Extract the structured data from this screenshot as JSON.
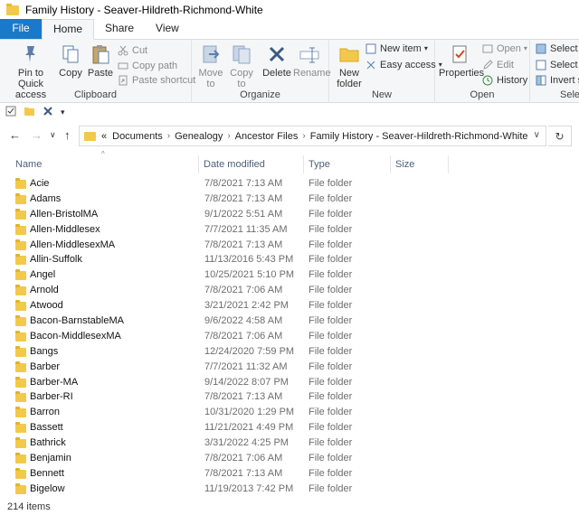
{
  "window": {
    "title": "Family History - Seaver-Hildreth-Richmond-White"
  },
  "tabs": [
    "File",
    "Home",
    "Share",
    "View"
  ],
  "ribbon": {
    "clipboard": {
      "label": "Clipboard",
      "pin": "Pin to Quick access",
      "copy": "Copy",
      "paste": "Paste",
      "cut": "Cut",
      "copy_path": "Copy path",
      "paste_shortcut": "Paste shortcut"
    },
    "organize": {
      "label": "Organize",
      "move_to": "Move to",
      "copy_to": "Copy to",
      "delete": "Delete",
      "rename": "Rename"
    },
    "new": {
      "label": "New",
      "new_folder": "New folder",
      "new_item": "New item",
      "easy_access": "Easy access"
    },
    "open": {
      "label": "Open",
      "properties": "Properties",
      "open": "Open",
      "edit": "Edit",
      "history": "History"
    },
    "select": {
      "label": "Selec",
      "select_all": "Select a",
      "select_none": "Select n",
      "invert": "Invert s"
    }
  },
  "address": {
    "prefix": "«",
    "crumbs": [
      "Documents",
      "Genealogy",
      "Ancestor Files",
      "Family History - Seaver-Hildreth-Richmond-White"
    ]
  },
  "columns": [
    "Name",
    "Date modified",
    "Type",
    "Size"
  ],
  "files": [
    {
      "name": "Acie",
      "date": "7/8/2021 7:13 AM",
      "type": "File folder"
    },
    {
      "name": "Adams",
      "date": "7/8/2021 7:13 AM",
      "type": "File folder"
    },
    {
      "name": "Allen-BristolMA",
      "date": "9/1/2022 5:51 AM",
      "type": "File folder"
    },
    {
      "name": "Allen-Middlesex",
      "date": "7/7/2021 11:35 AM",
      "type": "File folder"
    },
    {
      "name": "Allen-MiddlesexMA",
      "date": "7/8/2021 7:13 AM",
      "type": "File folder"
    },
    {
      "name": "Allin-Suffolk",
      "date": "11/13/2016 5:43 PM",
      "type": "File folder"
    },
    {
      "name": "Angel",
      "date": "10/25/2021 5:10 PM",
      "type": "File folder"
    },
    {
      "name": "Arnold",
      "date": "7/8/2021 7:06 AM",
      "type": "File folder"
    },
    {
      "name": "Atwood",
      "date": "3/21/2021 2:42 PM",
      "type": "File folder"
    },
    {
      "name": "Bacon-BarnstableMA",
      "date": "9/6/2022 4:58 AM",
      "type": "File folder"
    },
    {
      "name": "Bacon-MiddlesexMA",
      "date": "7/8/2021 7:06 AM",
      "type": "File folder"
    },
    {
      "name": "Bangs",
      "date": "12/24/2020 7:59 PM",
      "type": "File folder"
    },
    {
      "name": "Barber",
      "date": "7/7/2021 11:32 AM",
      "type": "File folder"
    },
    {
      "name": "Barber-MA",
      "date": "9/14/2022 8:07 PM",
      "type": "File folder"
    },
    {
      "name": "Barber-RI",
      "date": "7/8/2021 7:13 AM",
      "type": "File folder"
    },
    {
      "name": "Barron",
      "date": "10/31/2020 1:29 PM",
      "type": "File folder"
    },
    {
      "name": "Bassett",
      "date": "11/21/2021 4:49 PM",
      "type": "File folder"
    },
    {
      "name": "Bathrick",
      "date": "3/31/2022 4:25 PM",
      "type": "File folder"
    },
    {
      "name": "Benjamin",
      "date": "7/8/2021 7:06 AM",
      "type": "File folder"
    },
    {
      "name": "Bennett",
      "date": "7/8/2021 7:13 AM",
      "type": "File folder"
    },
    {
      "name": "Bigelow",
      "date": "11/19/2013 7:42 PM",
      "type": "File folder"
    }
  ],
  "status": {
    "count": "214 items"
  }
}
